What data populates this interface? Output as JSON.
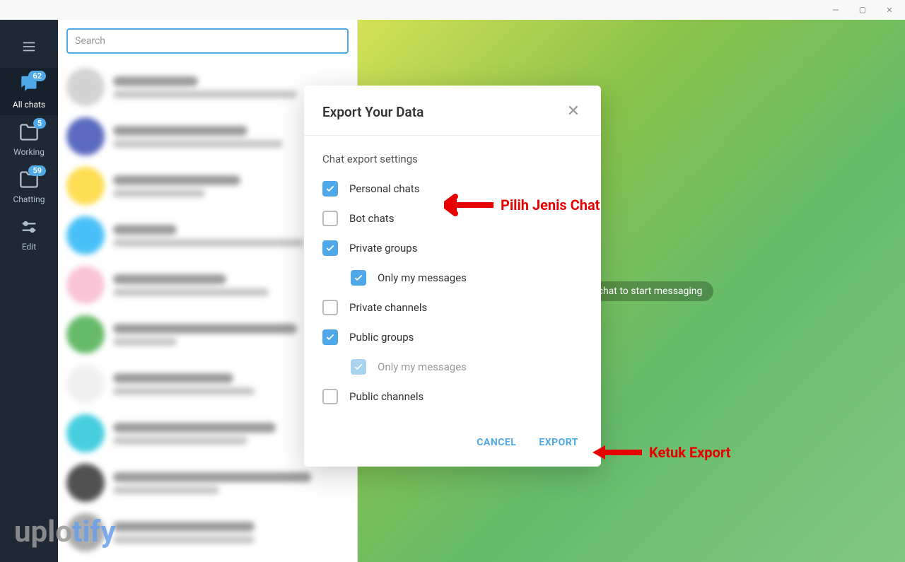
{
  "window": {
    "minimize": "—",
    "maximize": "▢",
    "close": "✕"
  },
  "sidebar": {
    "tabs": [
      {
        "label": "All chats",
        "badge": "62"
      },
      {
        "label": "Working",
        "badge": "5"
      },
      {
        "label": "Chatting",
        "badge": "59"
      },
      {
        "label": "Edit",
        "badge": ""
      }
    ]
  },
  "search": {
    "placeholder": "Search"
  },
  "main": {
    "start_hint": "Select a chat to start messaging"
  },
  "modal": {
    "title": "Export Your Data",
    "section": "Chat export settings",
    "items": {
      "personal": "Personal chats",
      "bot": "Bot chats",
      "private_groups": "Private groups",
      "only_my_1": "Only my messages",
      "private_channels": "Private channels",
      "public_groups": "Public groups",
      "only_my_2": "Only my messages",
      "public_channels": "Public channels"
    },
    "cancel": "CANCEL",
    "export": "EXPORT"
  },
  "annotations": {
    "a1": "Pilih Jenis Chat",
    "a2": "Ketuk Export"
  },
  "watermark": {
    "part1": "uplo",
    "part2": "tify"
  }
}
